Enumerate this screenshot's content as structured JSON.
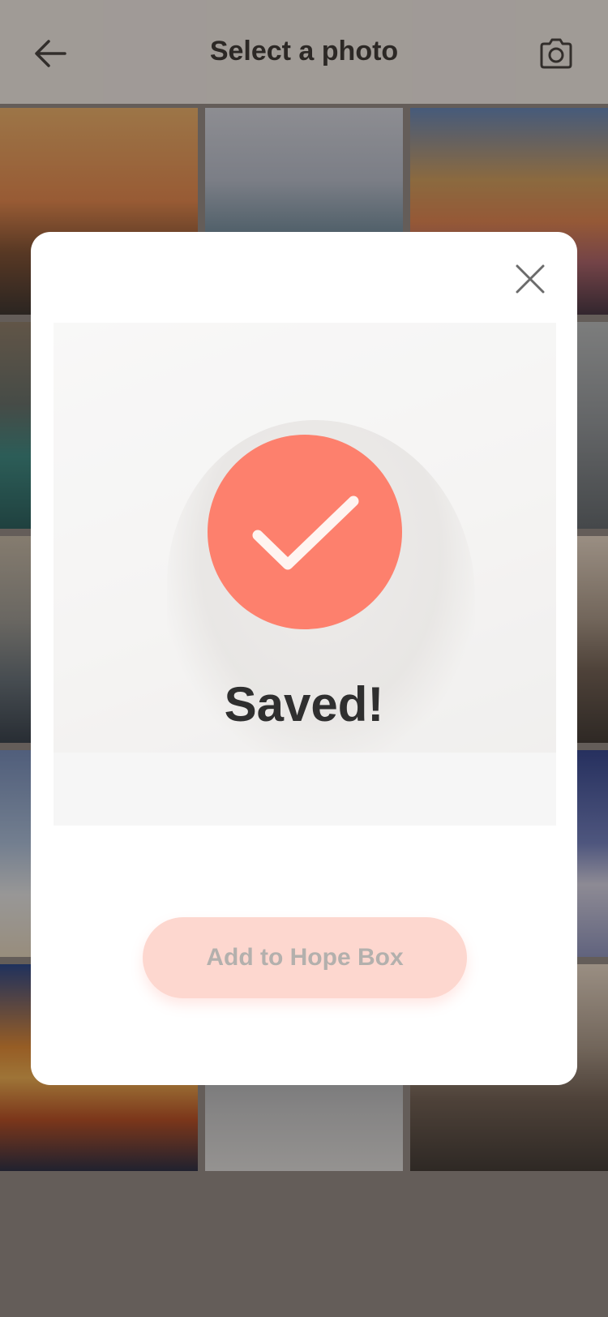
{
  "header": {
    "title": "Select a photo",
    "back_icon": "arrow-left-icon",
    "camera_icon": "camera-icon"
  },
  "grid": {
    "tiles": [
      {
        "name": "sunset-mountains-photo"
      },
      {
        "name": "valley-mountains-photo"
      },
      {
        "name": "sunset-clouds-photo"
      },
      {
        "name": "cliff-lake-photo"
      },
      {
        "name": "eagle-sky-photo"
      },
      {
        "name": "rock-sky-photo"
      },
      {
        "name": "sea-sunset-photo"
      },
      {
        "name": "beach-umbrella-photo"
      },
      {
        "name": "green-hills-photo"
      },
      {
        "name": "above-clouds-photo"
      },
      {
        "name": "orange-clouds-photo"
      },
      {
        "name": "snow-forest-photo"
      },
      {
        "name": "mountain-range-photo"
      }
    ]
  },
  "modal": {
    "close_icon": "close-icon",
    "status_text": "Saved!",
    "add_button_label": "Add to Hope Box"
  },
  "colors": {
    "accent": "#fd806d",
    "button_bg": "#fdd7cf",
    "button_text": "#b3b0ad",
    "title_text": "#2f2f2f"
  }
}
